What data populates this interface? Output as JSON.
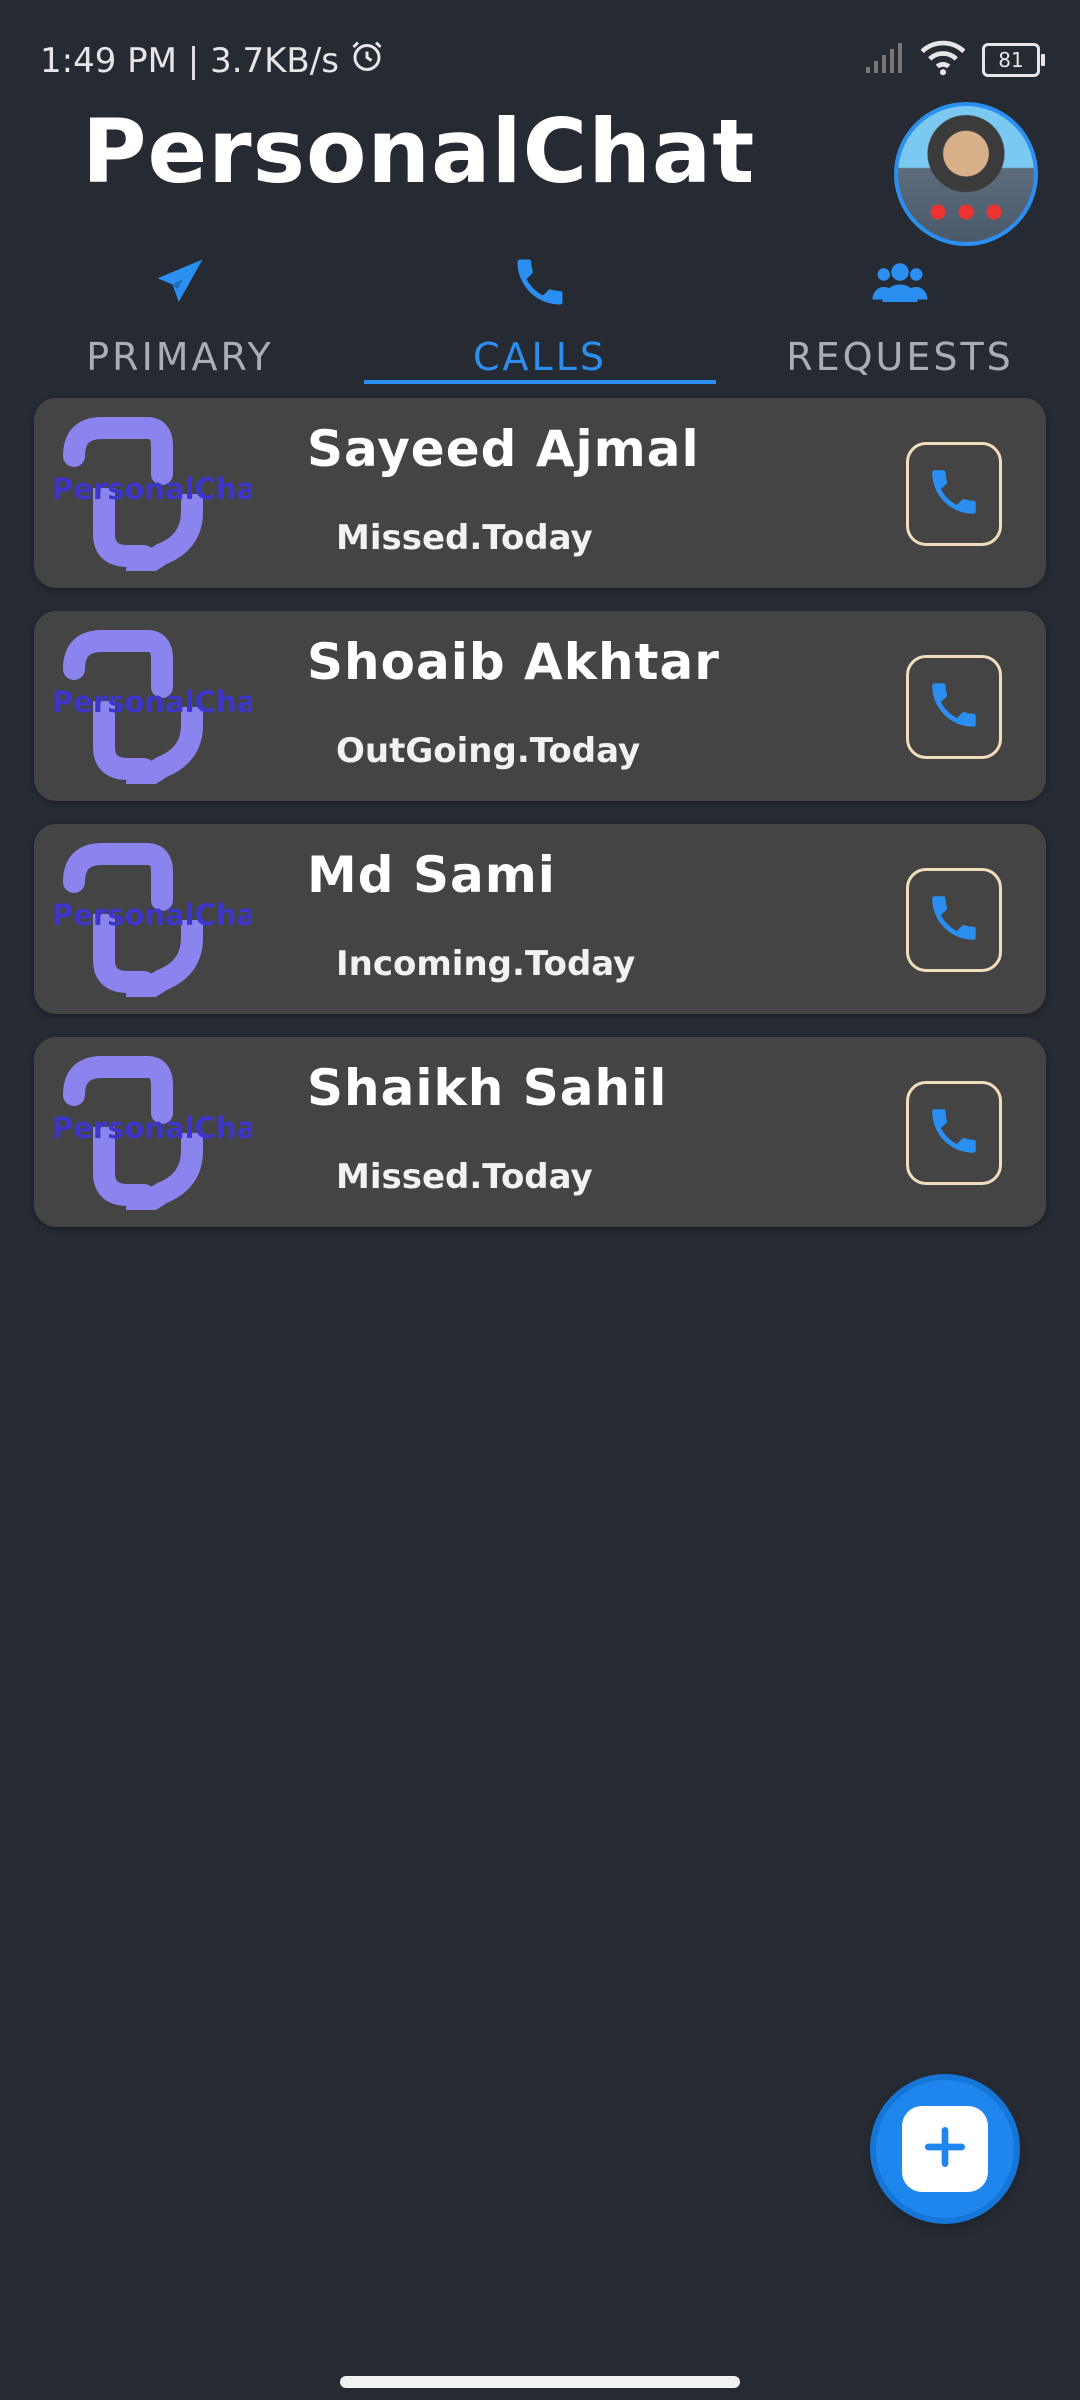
{
  "status_bar": {
    "time_speed": "1:49 PM | 3.7KB/s",
    "battery": "81"
  },
  "header": {
    "title": "PersonalChat"
  },
  "tabs": [
    {
      "label": "PRIMARY",
      "icon": "paper-plane-icon",
      "active": false
    },
    {
      "label": "CALLS",
      "icon": "phone-icon",
      "active": true
    },
    {
      "label": "REQUESTS",
      "icon": "users-icon",
      "active": false
    }
  ],
  "calls": [
    {
      "name": "Sayeed Ajmal",
      "status": "Missed.Today",
      "avatar_text": "PersonalCha"
    },
    {
      "name": "Shoaib Akhtar",
      "status": "OutGoing.Today",
      "avatar_text": "PersonalCha"
    },
    {
      "name": "Md Sami",
      "status": "Incoming.Today",
      "avatar_text": "PersonalCha"
    },
    {
      "name": "Shaikh Sahil",
      "status": "Missed.Today",
      "avatar_text": "PersonalCha"
    }
  ],
  "colors": {
    "background": "#262b33",
    "card": "#444444",
    "accent": "#2a8ff0",
    "logo": "#8b84ee",
    "call_button_border": "#f1dcbc"
  }
}
